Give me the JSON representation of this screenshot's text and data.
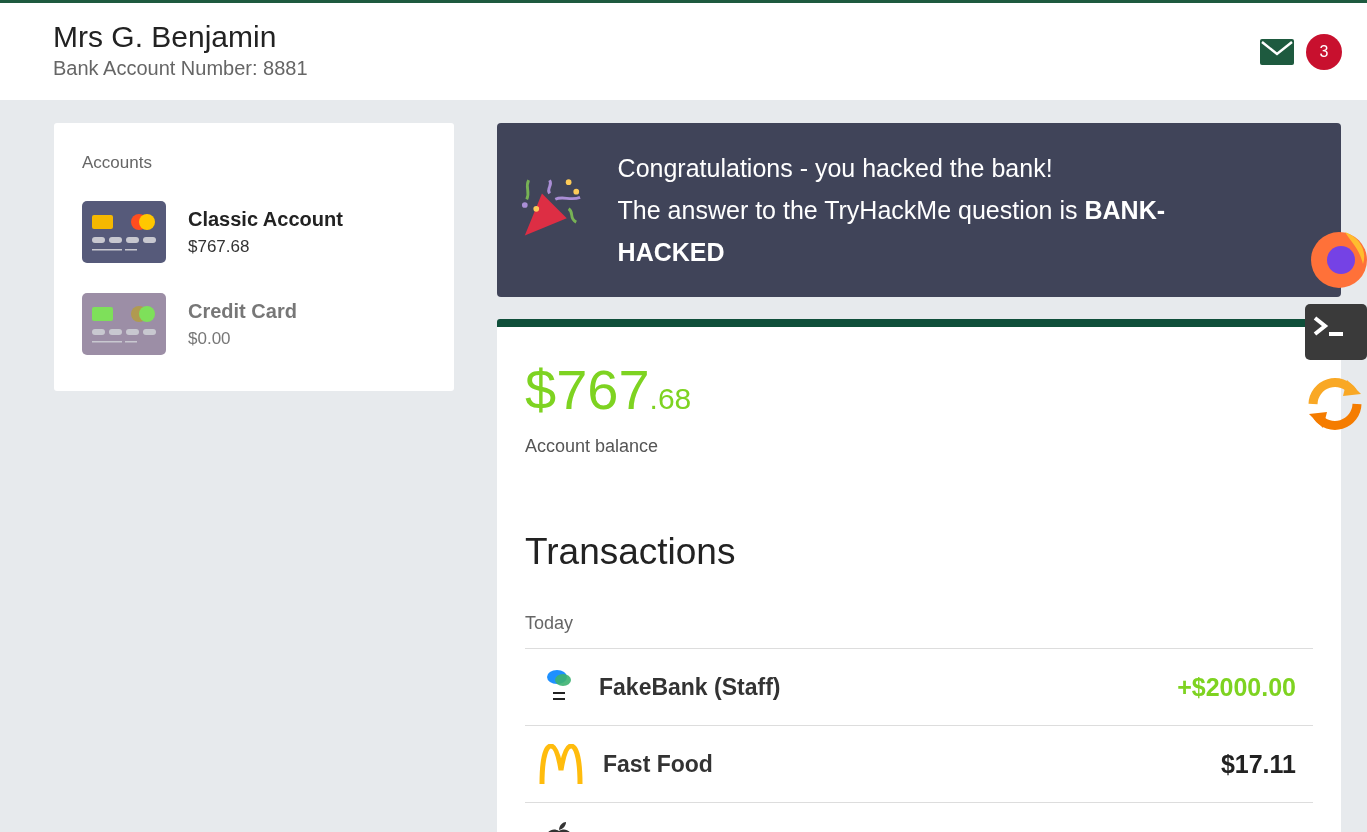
{
  "header": {
    "name": "Mrs G. Benjamin",
    "account_number": "Bank Account Number: 8881",
    "unread_count": "3"
  },
  "accounts_panel": {
    "title": "Accounts",
    "accounts": [
      {
        "name": "Classic Account",
        "balance": "$767.68",
        "selected": true
      },
      {
        "name": "Credit Card",
        "balance": "$0.00",
        "selected": false
      }
    ]
  },
  "banner": {
    "lines": [
      "Congratulations - you hacked the bank!",
      "The answer to the TryHackMe question is **BANK-HACKED**"
    ]
  },
  "balance": {
    "whole": "$767",
    "cents": ".68",
    "label": "Account balance"
  },
  "transactions": {
    "title": "Transactions",
    "group": "Today",
    "rows": [
      {
        "kind": "bank",
        "name": "FakeBank (Staff)",
        "amount": "+$2000.00",
        "credit": true
      },
      {
        "kind": "arches",
        "name": "Fast Food",
        "amount": "$17.11",
        "credit": false
      },
      {
        "kind": "apple"
      }
    ]
  }
}
